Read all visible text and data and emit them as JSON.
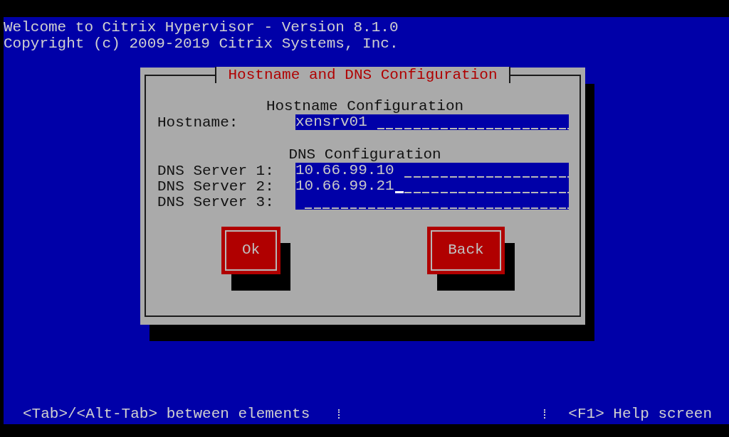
{
  "header": [
    "Welcome to Citrix Hypervisor - Version 8.1.0",
    "Copyright (c) 2009-2019 Citrix Systems, Inc."
  ],
  "dialog": {
    "title": "Hostname and DNS Configuration",
    "sections": [
      {
        "heading": "Hostname Configuration",
        "fields": [
          {
            "label": "Hostname:",
            "value": "xensrv01",
            "focused": false
          }
        ]
      },
      {
        "heading": "DNS Configuration",
        "fields": [
          {
            "label": "DNS Server 1:",
            "value": "10.66.99.10",
            "focused": false
          },
          {
            "label": "DNS Server 2:",
            "value": "10.66.99.21",
            "focused": true
          },
          {
            "label": "DNS Server 3:",
            "focused": false
          }
        ]
      }
    ],
    "buttons": [
      "Ok",
      "Back"
    ]
  },
  "status_bar": {
    "left": "<Tab>/<Alt-Tab> between elements",
    "right": "<F1> Help screen"
  }
}
